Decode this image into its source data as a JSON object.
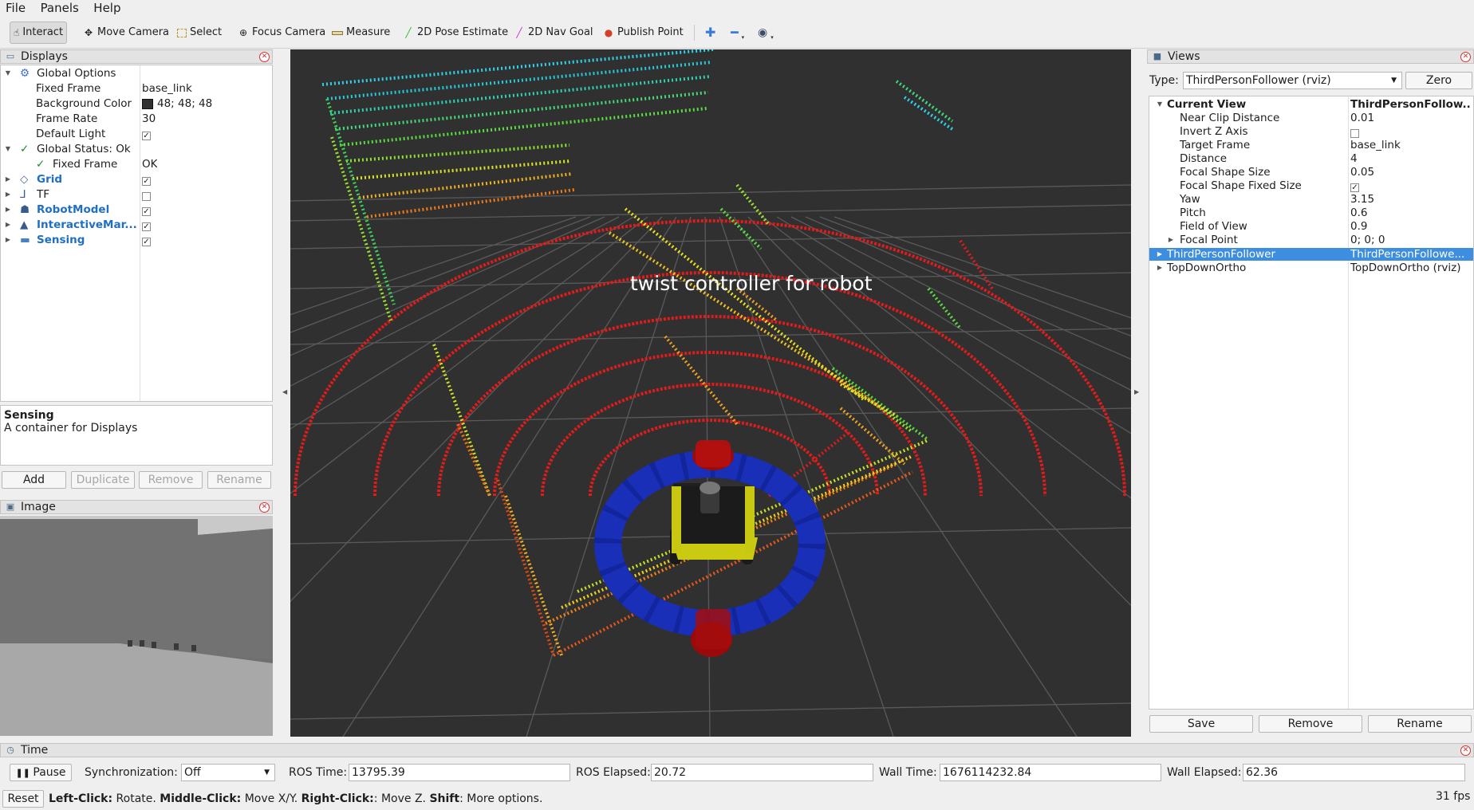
{
  "menu": [
    "File",
    "Panels",
    "Help"
  ],
  "toolbar": {
    "tools": [
      "Interact",
      "Move Camera",
      "Select",
      "Focus Camera",
      "Measure",
      "2D Pose Estimate",
      "2D Nav Goal",
      "Publish Point"
    ]
  },
  "displays": {
    "title": "Displays",
    "global_options": "Global Options",
    "fixed_frame_label": "Fixed Frame",
    "fixed_frame_value": "base_link",
    "bg_label": "Background Color",
    "bg_value": "48; 48; 48",
    "frame_rate_label": "Frame Rate",
    "frame_rate_value": "30",
    "default_light_label": "Default Light",
    "global_status": "Global Status: Ok",
    "status_fixed_frame": "Fixed Frame",
    "status_fixed_frame_value": "OK",
    "grid": "Grid",
    "tf": "TF",
    "robot_model": "RobotModel",
    "interactive": "InteractiveMar...",
    "sensing": "Sensing",
    "desc_title": "Sensing",
    "desc_text": "A container for Displays",
    "buttons": [
      "Add",
      "Duplicate",
      "Remove",
      "Rename"
    ]
  },
  "image_panel": {
    "title": "Image"
  },
  "viewport": {
    "overlay_text": "twist  controller  for  robot"
  },
  "views": {
    "title": "Views",
    "type_label": "Type:",
    "type_value": "ThirdPersonFollower (rviz)",
    "zero": "Zero",
    "current_view": "Current View",
    "current_view_value": "ThirdPersonFollow...",
    "props": [
      {
        "label": "Near Clip Distance",
        "value": "0.01"
      },
      {
        "label": "Invert Z Axis",
        "value": ""
      },
      {
        "label": "Target Frame",
        "value": "base_link"
      },
      {
        "label": "Distance",
        "value": "4"
      },
      {
        "label": "Focal Shape Size",
        "value": "0.05"
      },
      {
        "label": "Focal Shape Fixed Size",
        "value": ""
      },
      {
        "label": "Yaw",
        "value": "3.15"
      },
      {
        "label": "Pitch",
        "value": "0.6"
      },
      {
        "label": "Field of View",
        "value": "0.9"
      },
      {
        "label": "Focal Point",
        "value": "0; 0; 0"
      }
    ],
    "saved1_label": "ThirdPersonFollower",
    "saved1_value": "ThirdPersonFollowe...",
    "saved2_label": "TopDownOrtho",
    "saved2_value": "TopDownOrtho (rviz)",
    "buttons": [
      "Save",
      "Remove",
      "Rename"
    ]
  },
  "time": {
    "title": "Time",
    "pause": "Pause",
    "sync_label": "Synchronization:",
    "sync_value": "Off",
    "ros_time_label": "ROS Time:",
    "ros_time": "13795.39",
    "ros_elapsed_label": "ROS Elapsed:",
    "ros_elapsed": "20.72",
    "wall_time_label": "Wall Time:",
    "wall_time": "1676114232.84",
    "wall_elapsed_label": "Wall Elapsed:",
    "wall_elapsed": "62.36"
  },
  "status": {
    "reset": "Reset",
    "left_click": "Left-Click:",
    "left_text": " Rotate. ",
    "middle_click": "Middle-Click:",
    "middle_text": " Move X/Y. ",
    "right_click": "Right-Click:",
    "right_text": ": Move Z. ",
    "shift": "Shift",
    "shift_text": ": More options.",
    "fps": "31 fps"
  }
}
